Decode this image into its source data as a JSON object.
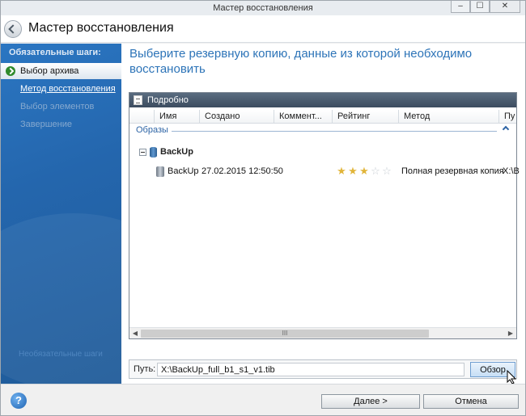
{
  "window": {
    "title": "Мастер восстановления",
    "controls": {
      "minimize": "–",
      "maximize": "☐",
      "close": "✕"
    }
  },
  "header": {
    "title": "Мастер восстановления"
  },
  "sidebar": {
    "heading": "Обязательные шаги:",
    "items": [
      {
        "label": "Выбор архива",
        "state": "active"
      },
      {
        "label": "Метод восстановления",
        "state": "link"
      },
      {
        "label": "Выбор элементов",
        "state": "disabled"
      },
      {
        "label": "Завершение",
        "state": "disabled"
      }
    ],
    "optional_heading": "Необязательные шаги"
  },
  "main": {
    "title": "Выберите резервную копию, данные из которой необходимо восстановить",
    "panel": {
      "title": "Подробно",
      "columns": [
        "Имя",
        "Создано",
        "Коммент...",
        "Рейтинг",
        "Метод",
        "Пу"
      ],
      "group_label": "Образы",
      "tree_parent": "BackUp",
      "rows": [
        {
          "name": "BackUp",
          "created": "27.02.2015 12:50:50",
          "comment": "",
          "rating": 3,
          "rating_max": 5,
          "method": "Полная резервная копия",
          "path": "X:\\B"
        }
      ],
      "scrollbar_grip": "III"
    },
    "path": {
      "label": "Путь:",
      "value": "X:\\BackUp_full_b1_s1_v1.tib",
      "browse_label": "Обзор"
    }
  },
  "footer": {
    "help": "?",
    "next_label": "Далее >",
    "cancel_label": "Отмена"
  },
  "colors": {
    "sidebar_blue": "#2466ad",
    "accent_title": "#2d74b8",
    "panel_header": "#3c4c5f",
    "star": "#e1b53a"
  },
  "icons": [
    "back-arrow-icon",
    "green-arrow-icon",
    "details-icon",
    "collapse-minus-icon",
    "database-icon",
    "disk-image-icon",
    "star-icon",
    "help-icon",
    "mouse-cursor-icon"
  ]
}
